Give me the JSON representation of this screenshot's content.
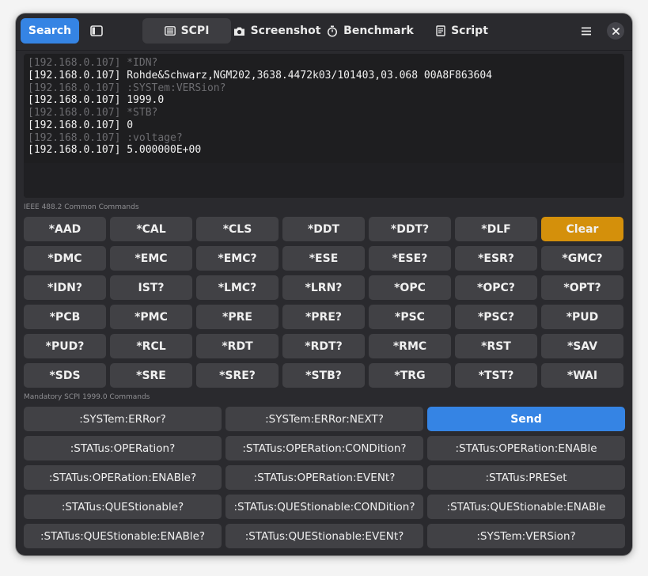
{
  "header": {
    "search_label": "Search",
    "tabs": [
      {
        "label": "SCPI",
        "icon": "keyboard-icon",
        "active": true
      },
      {
        "label": "Screenshot",
        "icon": "camera-icon",
        "active": false
      },
      {
        "label": "Benchmark",
        "icon": "stopwatch-icon",
        "active": false
      },
      {
        "label": "Script",
        "icon": "document-icon",
        "active": false
      }
    ]
  },
  "console": {
    "lines": [
      {
        "kind": "cmd",
        "text": "[192.168.0.107] *IDN?"
      },
      {
        "kind": "resp",
        "text": "[192.168.0.107] Rohde&Schwarz,NGM202,3638.4472k03/101403,03.068 00A8F863604"
      },
      {
        "kind": "cmd",
        "text": "[192.168.0.107] :SYSTem:VERSion?"
      },
      {
        "kind": "resp",
        "text": "[192.168.0.107] 1999.0"
      },
      {
        "kind": "cmd",
        "text": "[192.168.0.107] *STB?"
      },
      {
        "kind": "resp",
        "text": "[192.168.0.107] 0"
      },
      {
        "kind": "cmd",
        "text": "[192.168.0.107] :voltage?"
      },
      {
        "kind": "resp",
        "text": "[192.168.0.107] 5.000000E+00"
      }
    ]
  },
  "ieee_section": {
    "label": "IEEE 488.2 Common Commands",
    "buttons": [
      "*AAD",
      "*CAL",
      "*CLS",
      "*DDT",
      "*DDT?",
      "*DLF",
      "Clear",
      "*DMC",
      "*EMC",
      "*EMC?",
      "*ESE",
      "*ESE?",
      "*ESR?",
      "*GMC?",
      "*IDN?",
      "IST?",
      "*LMC?",
      "*LRN?",
      "*OPC",
      "*OPC?",
      "*OPT?",
      "*PCB",
      "*PMC",
      "*PRE",
      "*PRE?",
      "*PSC",
      "*PSC?",
      "*PUD",
      "*PUD?",
      "*RCL",
      "*RDT",
      "*RDT?",
      "*RMC",
      "*RST",
      "*SAV",
      "*SDS",
      "*SRE",
      "*SRE?",
      "*STB?",
      "*TRG",
      "*TST?",
      "*WAI"
    ]
  },
  "scpi_section": {
    "label": "Mandatory SCPI 1999.0 Commands",
    "buttons": [
      ":SYSTem:ERRor?",
      ":SYSTem:ERRor:NEXT?",
      "Send",
      ":STATus:OPERation?",
      ":STATus:OPERation:CONDition?",
      ":STATus:OPERation:ENABle",
      ":STATus:OPERation:ENABle?",
      ":STATus:OPERation:EVENt?",
      ":STATus:PRESet",
      ":STATus:QUEStionable?",
      ":STATus:QUEStionable:CONDition?",
      ":STATus:QUEStionable:ENABle",
      ":STATus:QUEStionable:ENABle?",
      ":STATus:QUEStionable:EVENt?",
      ":SYSTem:VERSion?"
    ]
  },
  "colors": {
    "accent": "#3584e4",
    "clear": "#d4900b",
    "window_bg": "#2a2a2e",
    "button_bg": "#414145"
  }
}
